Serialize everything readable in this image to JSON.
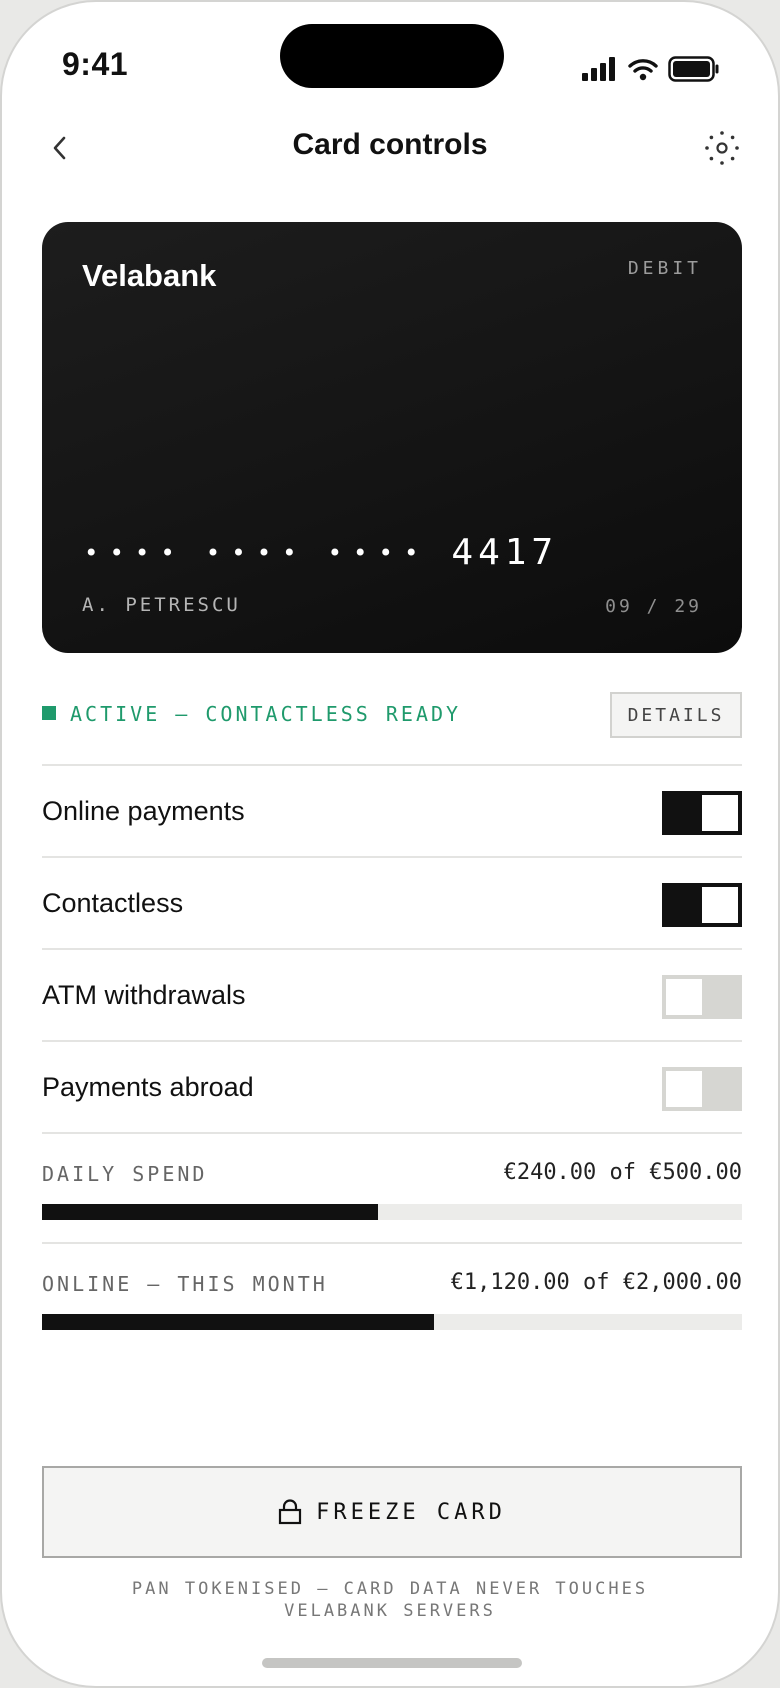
{
  "status_bar": {
    "time": "9:41"
  },
  "nav": {
    "title": "Card controls"
  },
  "card": {
    "brand": "Velabank",
    "type": "DEBIT",
    "masked_groups": [
      "••••",
      "••••",
      "••••"
    ],
    "last4": "4417",
    "holder": "A. PETRESCU",
    "expiry": "09 / 29"
  },
  "card_status": {
    "text": "ACTIVE — CONTACTLESS READY",
    "color": "#1f9a6c",
    "details_label": "DETAILS"
  },
  "toggles": [
    {
      "label": "Online payments",
      "on": true
    },
    {
      "label": "Contactless",
      "on": true
    },
    {
      "label": "ATM withdrawals",
      "on": false
    },
    {
      "label": "Payments abroad",
      "on": false
    }
  ],
  "limits": [
    {
      "label": "DAILY SPEND",
      "value": "€240.00 of €500.00",
      "fraction": 0.48
    },
    {
      "label": "ONLINE — THIS MONTH",
      "value": "€1,120.00 of €2,000.00",
      "fraction": 0.56
    }
  ],
  "freeze": {
    "label": "FREEZE CARD",
    "icon": "lock-icon"
  },
  "footnote": "PAN TOKENISED — CARD DATA NEVER TOUCHES VELABANK SERVERS",
  "icons": {
    "back": "chevron-left-icon",
    "settings": "gear-icon",
    "signal": "signal-icon",
    "wifi": "wifi-icon",
    "battery": "battery-icon"
  },
  "colors": {
    "accent_active": "#1f9a6c",
    "card_background": "#161616",
    "switch_on": "#111111",
    "switch_off": "#d6d6d2"
  }
}
